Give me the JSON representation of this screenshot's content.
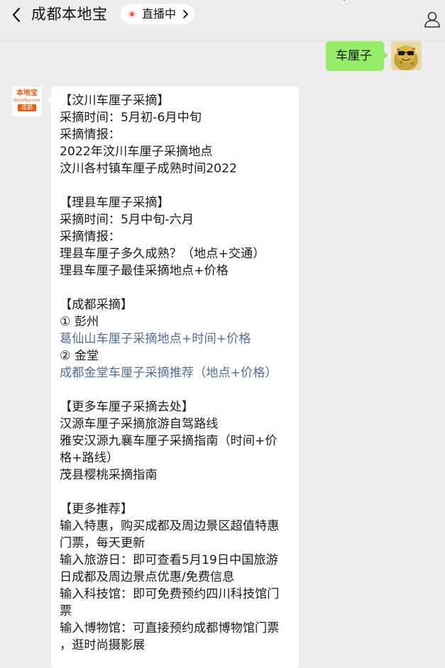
{
  "header": {
    "title": "成都本地宝",
    "live_label": "直播中"
  },
  "icons": {
    "back": "chevron-left-icon",
    "live_dot": "live-dot-icon",
    "live_chevron": "chevron-right-icon",
    "profile": "person-icon"
  },
  "colors": {
    "background": "#ededed",
    "sent_bubble": "#95ec69",
    "received_bubble": "#ffffff",
    "link": "#576b95",
    "live_dot": "#f25b5b",
    "logo_orange": "#e8590c"
  },
  "sent_message": {
    "text": "车厘子"
  },
  "received_avatar": {
    "logo_text": "本地宝",
    "logo_sub": "BenDiBao.com",
    "logo_city": "成都"
  },
  "received_message": {
    "lines": [
      {
        "text": "【汶川车厘子采摘】",
        "link": false
      },
      {
        "text": "采摘时间：5月初-6月中旬",
        "link": false
      },
      {
        "text": "采摘情报：",
        "link": false
      },
      {
        "text": "2022年汶川车厘子采摘地点",
        "link": false
      },
      {
        "text": "汶川各村镇车厘子成熟时间2022",
        "link": false
      },
      {
        "text": "",
        "link": false
      },
      {
        "text": "【理县车厘子采摘】",
        "link": false
      },
      {
        "text": "采摘时间：5月中旬-六月",
        "link": false
      },
      {
        "text": "采摘情报：",
        "link": false
      },
      {
        "text": "理县车厘子多久成熟？（地点+交通）",
        "link": false
      },
      {
        "text": "理县车厘子最佳采摘地点+价格",
        "link": false
      },
      {
        "text": "",
        "link": false
      },
      {
        "text": "【成都采摘】",
        "link": false
      },
      {
        "text": "① 彭州",
        "link": false
      },
      {
        "text": "葛仙山车厘子采摘地点+时间+价格",
        "link": true
      },
      {
        "text": "② 金堂",
        "link": false
      },
      {
        "text": "成都金堂车厘子采摘推荐（地点+价格）",
        "link": true
      },
      {
        "text": "",
        "link": false
      },
      {
        "text": "【更多车厘子采摘去处】",
        "link": false
      },
      {
        "text": "汉源车厘子采摘旅游自驾路线",
        "link": false
      },
      {
        "text": "雅安汉源九襄车厘子采摘指南（时间+价",
        "link": false
      },
      {
        "text": "格+路线）",
        "link": false
      },
      {
        "text": "茂县樱桃采摘指南",
        "link": false
      },
      {
        "text": "",
        "link": false
      },
      {
        "text": "【更多推荐】",
        "link": false
      },
      {
        "text": "输入特惠，购买成都及周边景区超值特惠",
        "link": false
      },
      {
        "text": "门票，每天更新",
        "link": false
      },
      {
        "text": "输入旅游日：即可查看5月19日中国旅游",
        "link": false
      },
      {
        "text": "日成都及周边景点优惠/免费信息",
        "link": false
      },
      {
        "text": "输入科技馆：即可免费预约四川科技馆门",
        "link": false
      },
      {
        "text": "票",
        "link": false
      },
      {
        "text": "输入博物馆：可直接预约成都博物馆门票",
        "link": false
      },
      {
        "text": "，逛时尚摄影展",
        "link": false
      }
    ]
  }
}
